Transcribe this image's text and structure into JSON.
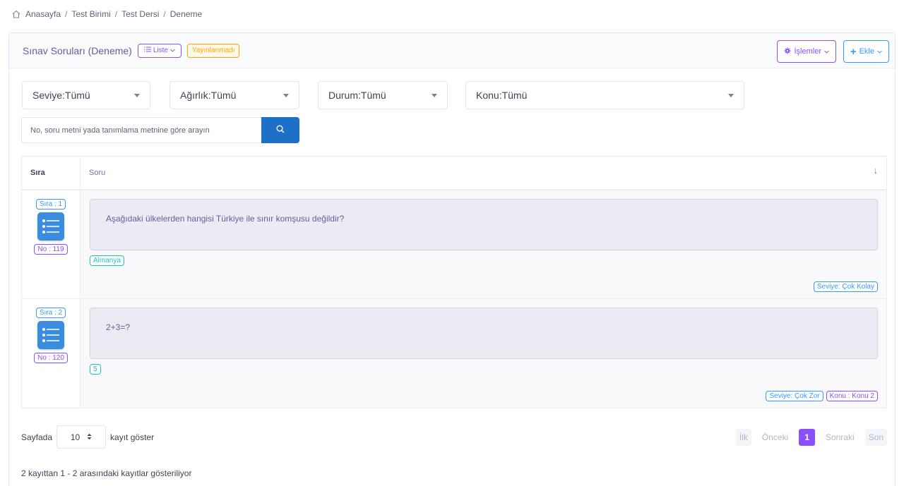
{
  "breadcrumb": {
    "items": [
      "Anasayfa",
      "Test Birimi",
      "Test Dersi",
      "Deneme"
    ],
    "separator": "/"
  },
  "header": {
    "title": "Sınav Soruları (Deneme)",
    "view_button": "Liste",
    "status_badge": "Yayınlanmadı",
    "actions_button": "İşlemler",
    "add_button": "Ekle"
  },
  "filters": {
    "level": "Seviye:Tümü",
    "weight": "Ağırlık:Tümü",
    "status": "Durum:Tümü",
    "topic": "Konu:Tümü"
  },
  "search": {
    "placeholder": "No, soru metni yada tanımlama metnine göre arayın",
    "value": ""
  },
  "table": {
    "headers": {
      "order": "Sıra",
      "question": "Soru"
    },
    "rows": [
      {
        "order": "Sıra : 1",
        "number": "No : 119",
        "question": "Aşağıdaki ülkelerden hangisi Türkiye ile sınır komşusu değildir?",
        "answer": "Almanya",
        "tags": [
          "Seviye: Çok Kolay"
        ]
      },
      {
        "order": "Sıra : 2",
        "number": "No : 120",
        "question": "2+3=?",
        "answer": "5",
        "tags": [
          "Seviye: Çok Zor",
          "Konu : Konu 2"
        ]
      }
    ]
  },
  "length_menu": {
    "prefix": "Sayfada",
    "value": "10",
    "suffix": "kayıt göster"
  },
  "pagination": {
    "first": "İlk",
    "previous": "Önceki",
    "current": "1",
    "next": "Sonraki",
    "last": "Son"
  },
  "info_text": "2 kayıttan 1 - 2 arasındaki kayıtlar gösteriliyor",
  "colors": {
    "primary": "#3699ff",
    "purple": "#8950fc",
    "warning": "#ffa800",
    "teal": "#1bc5bd",
    "search_button": "#1e6fc8"
  }
}
